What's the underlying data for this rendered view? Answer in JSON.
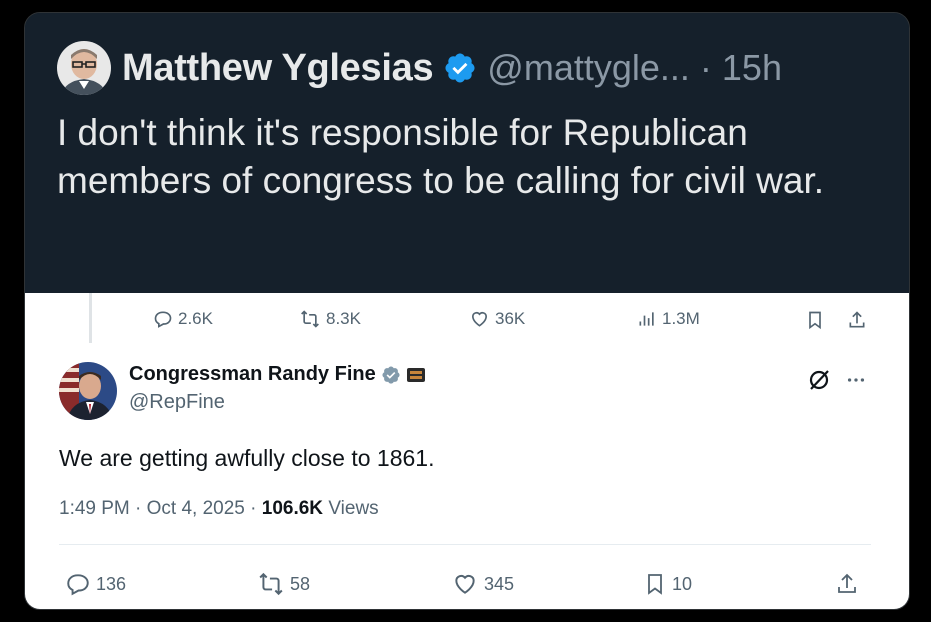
{
  "quote_tweet": {
    "author_name": "Matthew Yglesias",
    "author_handle": "@mattygle...",
    "separator": "·",
    "time": "15h",
    "text": "I don't think it's responsible for Republican members of congress to be calling for civil war.",
    "verified_color": "#1d9bf0"
  },
  "parent_metrics": {
    "replies": "2.6K",
    "reposts": "8.3K",
    "likes": "36K",
    "views": "1.3M"
  },
  "embedded_tweet": {
    "author_name": "Congressman Randy Fine",
    "author_handle": "@RepFine",
    "text": "We are getting awfully close to 1861.",
    "timestamp": "1:49 PM · Oct 4, 2025 · ",
    "views_count": "106.6K",
    "views_label": " Views",
    "verified_color": "#829aab",
    "metrics": {
      "replies": "136",
      "reposts": "58",
      "likes": "345",
      "bookmarks": "10"
    }
  },
  "colors": {
    "dark_bg": "#15202b",
    "light_bg": "#ffffff",
    "muted_text": "#536471",
    "dark_muted_text": "#8b98a5"
  },
  "icons": [
    "verified-badge-icon",
    "reply-icon",
    "repost-icon",
    "like-icon",
    "views-icon",
    "bookmark-icon",
    "share-icon",
    "grok-icon",
    "more-icon",
    "congress-badge-icon"
  ]
}
